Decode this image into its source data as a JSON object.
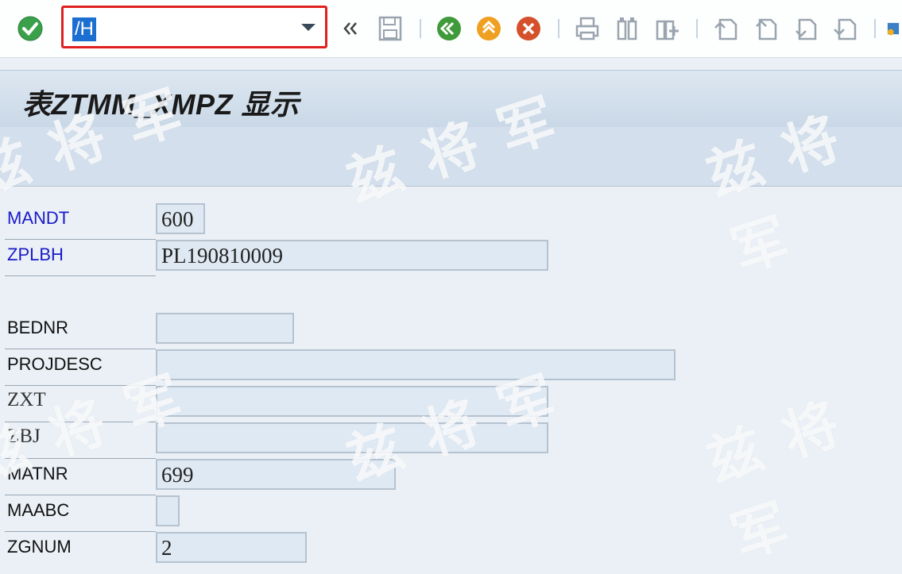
{
  "toolbar": {
    "command_value": "/H",
    "icons": [
      "confirm-icon",
      "double-chevron-left-icon",
      "save-icon",
      "back-icon",
      "exit-icon",
      "cancel-icon",
      "print-icon",
      "find-icon",
      "find-next-icon",
      "first-page-icon",
      "previous-page-icon",
      "next-page-icon",
      "last-page-icon",
      "settings-icon"
    ]
  },
  "title": {
    "text": "表ZTMM_XMPZ 显示"
  },
  "fields": [
    {
      "label": "MANDT",
      "value": "600"
    },
    {
      "label": "ZPLBH",
      "value": "PL190810009"
    },
    {
      "label": "BEDNR",
      "value": ""
    },
    {
      "label": "PROJDESC",
      "value": ""
    },
    {
      "label": "ZXT",
      "value": ""
    },
    {
      "label": "ZBJ",
      "value": ""
    },
    {
      "label": "MATNR",
      "value": "699"
    },
    {
      "label": "MAABC",
      "value": ""
    },
    {
      "label": "ZGNUM",
      "value": "2"
    }
  ],
  "watermark": {
    "text": "兹将军"
  },
  "colors": {
    "label_key": "#1a1ac8",
    "highlight": "#e02020",
    "selection": "#1b6fd0"
  }
}
